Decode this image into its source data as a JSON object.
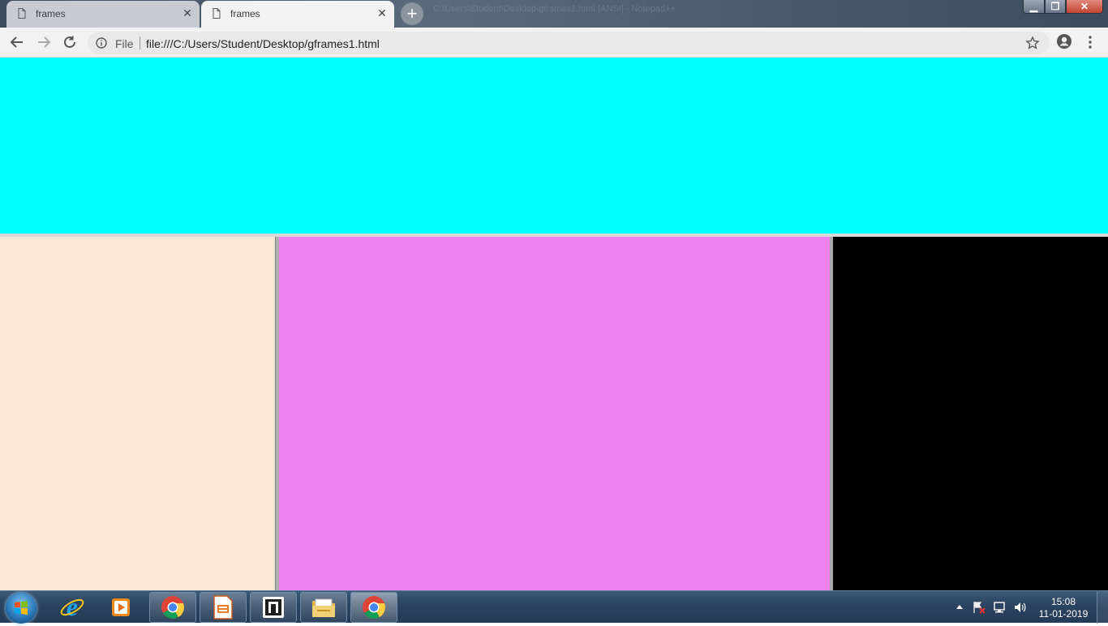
{
  "browser": {
    "tabs": [
      {
        "title": "frames",
        "active": false
      },
      {
        "title": "frames",
        "active": true
      }
    ],
    "background_window_title": "C:\\Users\\Student\\Desktop\\gframes1.html [ANSI] - Notepad++",
    "omnibox": {
      "scheme_label": "File",
      "url": "file:///C:/Users/Student/Desktop/gframes1.html"
    },
    "icons": [
      "back-icon",
      "forward-icon",
      "reload-icon",
      "info-icon",
      "star-icon",
      "account-icon",
      "menu-icon"
    ]
  },
  "frames": {
    "top_color": "#00ffff",
    "left_color": "#fae8d6",
    "middle_color": "#ee82ee",
    "right_color": "#000000"
  },
  "taskbar": {
    "pinned": [
      "start-orb",
      "internet-explorer-icon",
      "media-player-icon",
      "chrome-icon",
      "impress-icon",
      "notepad-plus-plus-icon",
      "file-explorer-icon",
      "chrome-active-icon"
    ],
    "clock": {
      "time": "15:08",
      "date": "11-01-2019"
    }
  }
}
